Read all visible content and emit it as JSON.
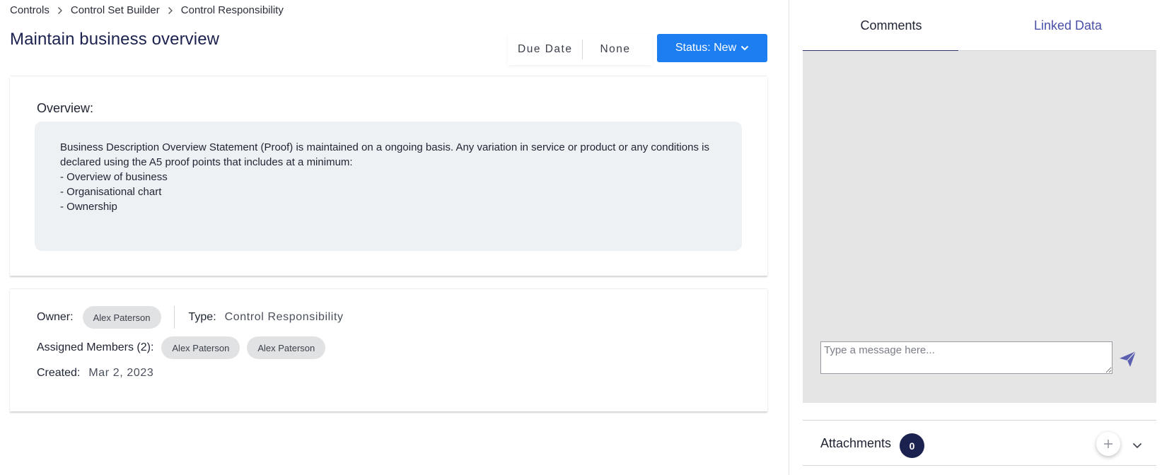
{
  "breadcrumb": [
    {
      "label": "Controls"
    },
    {
      "label": "Control Set Builder"
    },
    {
      "label": "Control Responsibility"
    }
  ],
  "page_title": "Maintain business overview",
  "due_date": {
    "label": "Due Date",
    "value": "None"
  },
  "status_button": {
    "label": "Status: New"
  },
  "overview": {
    "label": "Overview:",
    "text": "Business Description Overview Statement (Proof) is maintained on a ongoing basis. Any variation in service or product or any conditions is\ndeclared using the A5 proof points that includes at a minimum:\n- Overview of business\n- Organisational chart\n- Ownership"
  },
  "details": {
    "owner_label": "Owner:",
    "owner": "Alex Paterson",
    "type_label": "Type:",
    "type": "Control Responsibility",
    "assigned_label": "Assigned Members (2):",
    "assigned_members": [
      "Alex Paterson",
      "Alex Paterson"
    ],
    "created_label": "Created:",
    "created": "Mar 2, 2023"
  },
  "panel": {
    "tabs": [
      {
        "label": "Comments",
        "active": true
      },
      {
        "label": "Linked Data",
        "active": false
      }
    ],
    "message_placeholder": "Type a message here...",
    "attachments_label": "Attachments",
    "attachments_count": "0"
  },
  "colors": {
    "status_button": "#1c7ef0",
    "title": "#1c2250",
    "badge": "#1c2250",
    "send_icon": "#5a5fb0",
    "linked_tab": "#4a4fa8"
  },
  "icons": {
    "breadcrumb_separator": "chevron-right-icon",
    "status_dropdown": "chevron-down-icon",
    "send": "paper-plane-icon",
    "add_attachment": "plus-icon",
    "attachments_expand": "chevron-down-icon"
  }
}
